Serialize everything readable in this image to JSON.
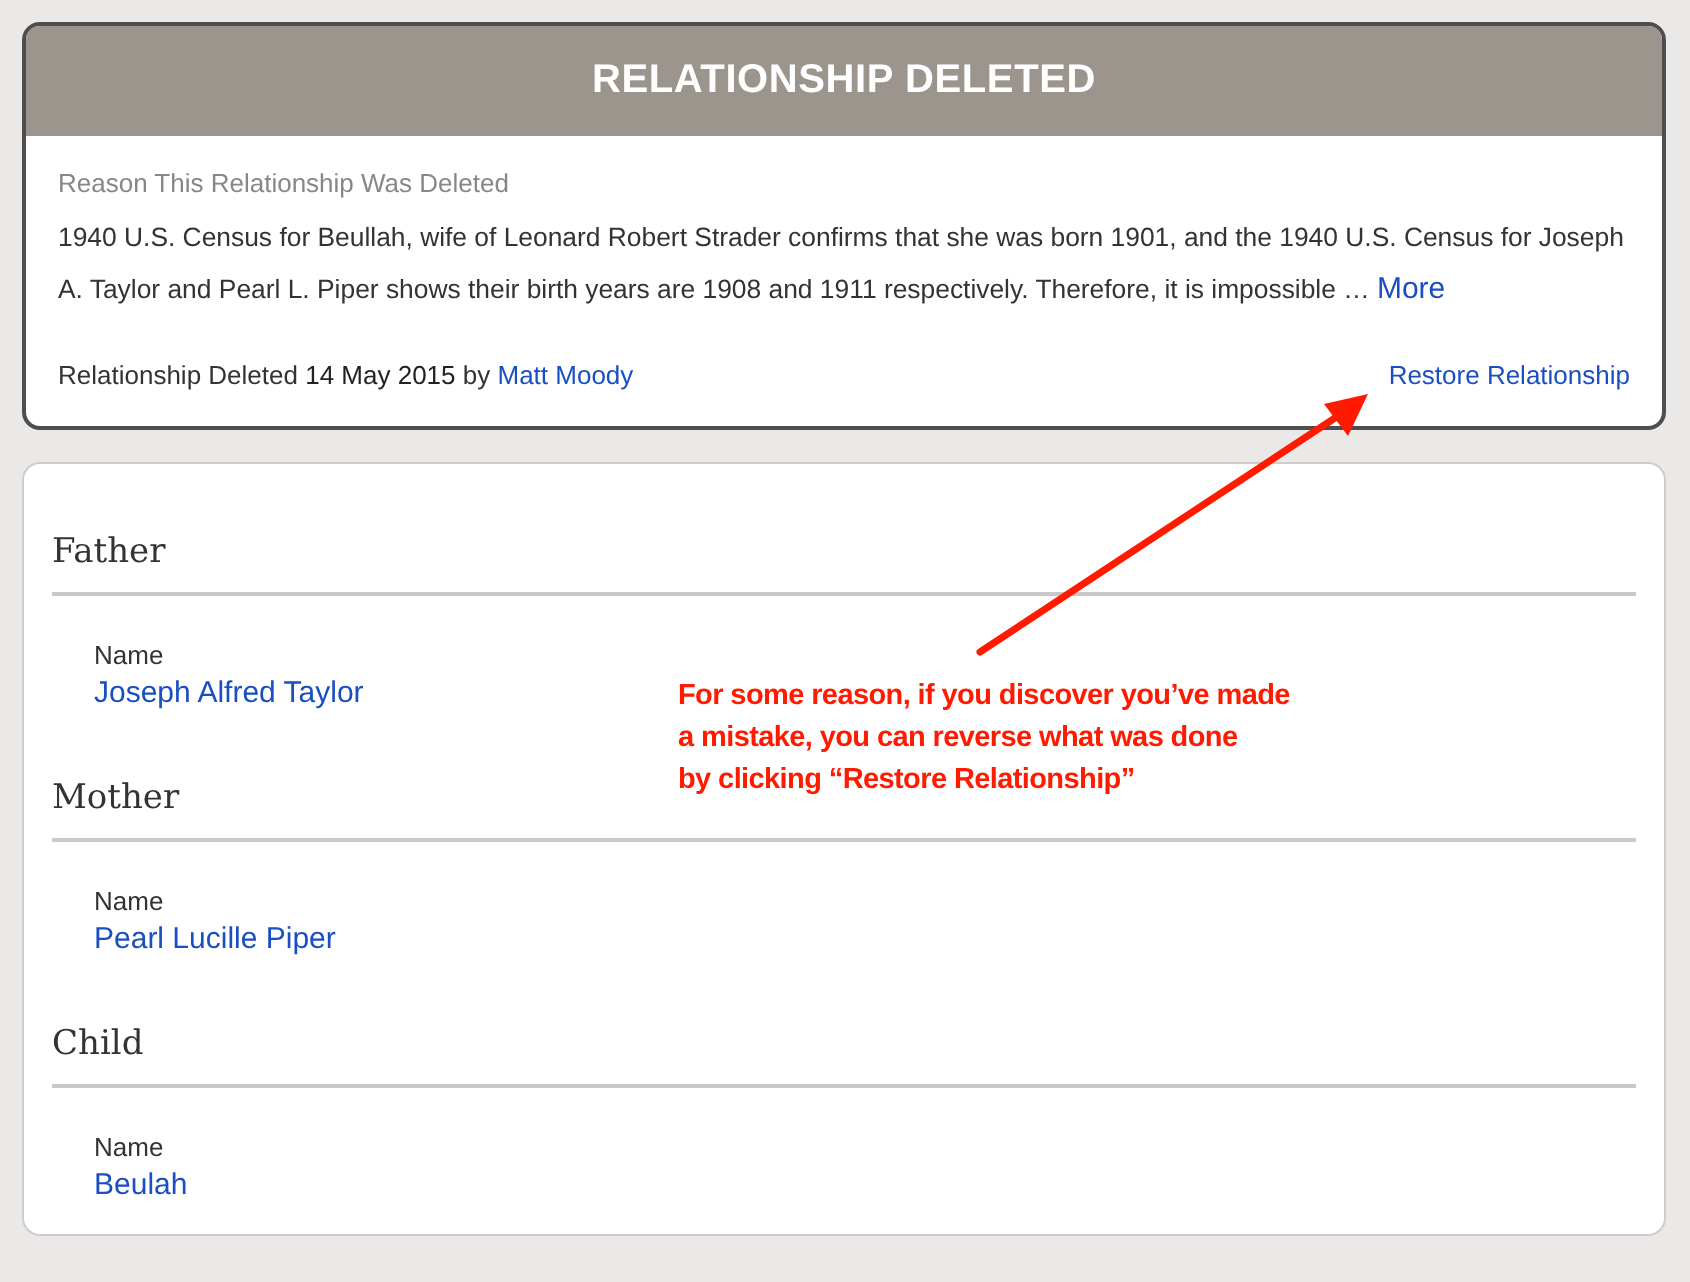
{
  "deleted_card": {
    "title": "RELATIONSHIP DELETED",
    "reason_label": "Reason This Relationship Was Deleted",
    "reason": "1940 U.S. Census for Beullah, wife of Leonard Robert Strader confirms that she was born 1901, and the 1940 U.S. Census for Joseph A. Taylor and Pearl L. Piper shows their birth years are 1908 and 1911 respectively. Therefore, it is impossible …",
    "more_link": "More",
    "deleted_text": "Relationship Deleted",
    "deleted_date": "14 May 2015",
    "by_text": "by",
    "author": "Matt Moody",
    "restore_link": "Restore Relationship"
  },
  "sections": [
    {
      "heading": "Father",
      "field_label": "Name",
      "value": "Joseph Alfred Taylor"
    },
    {
      "heading": "Mother",
      "field_label": "Name",
      "value": "Pearl Lucille Piper"
    },
    {
      "heading": "Child",
      "field_label": "Name",
      "value": "Beulah"
    }
  ],
  "annotation": {
    "lines": [
      "For some reason, if you discover you’ve made",
      "a mistake, you can reverse what was done",
      "by clicking “Restore Relationship”"
    ]
  }
}
